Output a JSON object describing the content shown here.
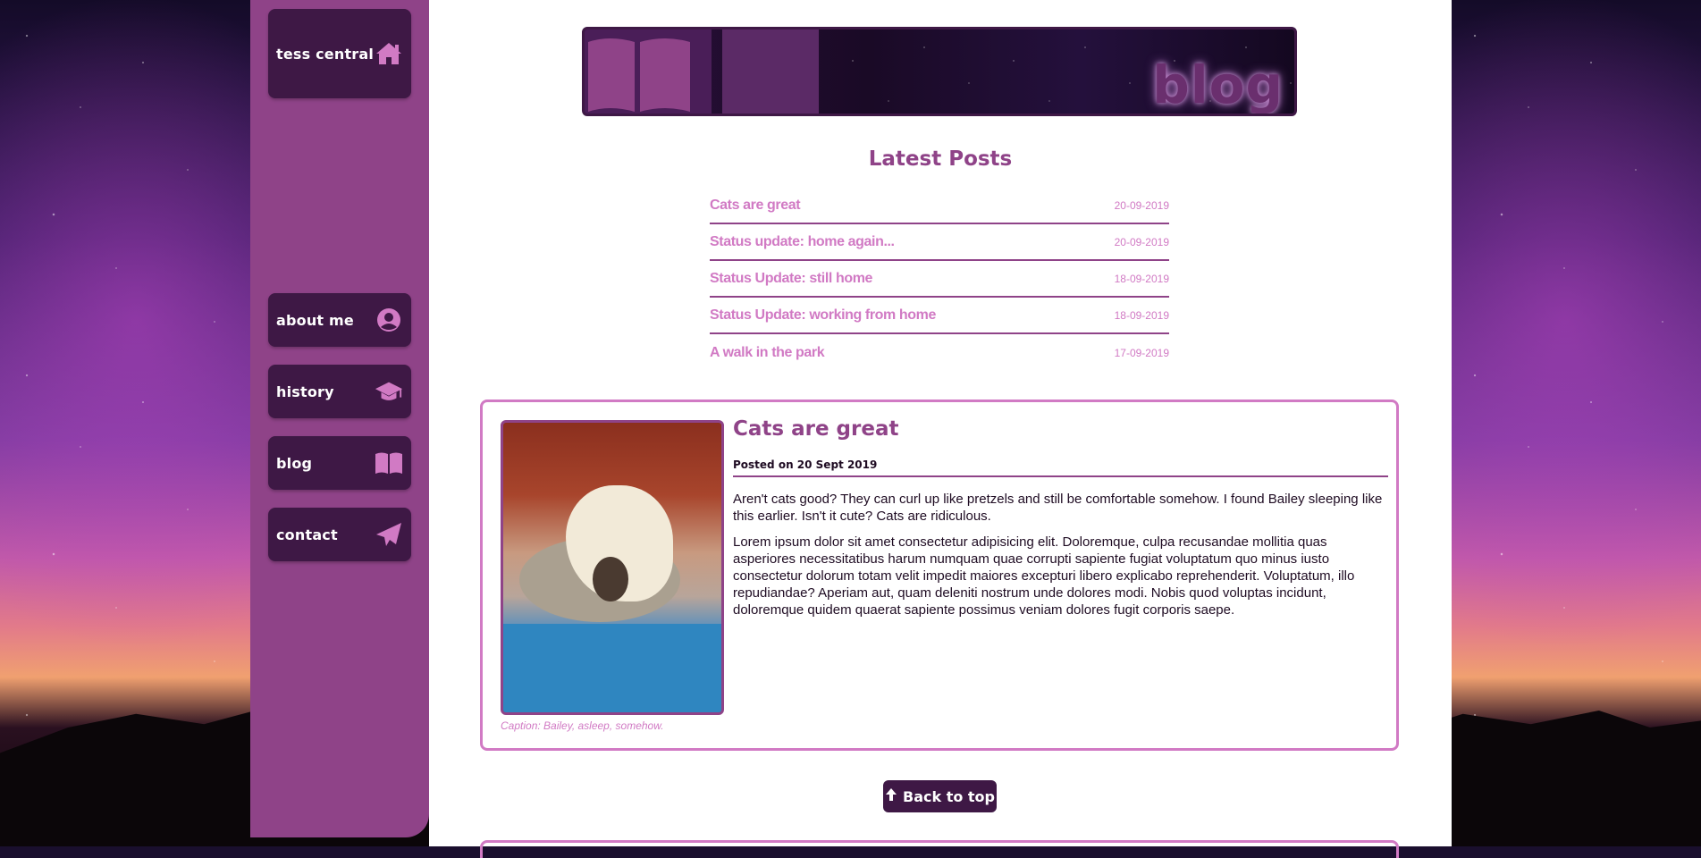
{
  "nav": {
    "home": "tess central",
    "items": [
      {
        "label": "about me",
        "icon": "user-circle-icon"
      },
      {
        "label": "history",
        "icon": "graduation-cap-icon"
      },
      {
        "label": "blog",
        "icon": "book-open-icon"
      },
      {
        "label": "contact",
        "icon": "paper-plane-icon"
      }
    ]
  },
  "banner": {
    "title": "blog"
  },
  "latest": {
    "heading": "Latest Posts",
    "posts": [
      {
        "title": "Cats are great",
        "date": "20-09-2019"
      },
      {
        "title": "Status update: home again...",
        "date": "20-09-2019"
      },
      {
        "title": "Status Update: still home",
        "date": "18-09-2019"
      },
      {
        "title": "Status Update: working from home",
        "date": "18-09-2019"
      },
      {
        "title": "A walk in the park",
        "date": "17-09-2019"
      }
    ]
  },
  "post": {
    "title": "Cats are great",
    "meta": "Posted on 20 Sept 2019",
    "caption": "Caption: Bailey, asleep, somehow.",
    "paragraphs": [
      "Aren't cats good? They can curl up like pretzels and still be comfortable somehow. I found Bailey sleeping like this earlier. Isn't it cute? Cats are ridiculous.",
      "Lorem ipsum dolor sit amet consectetur adipisicing elit. Doloremque, culpa recusandae mollitia quas asperiores necessitatibus harum numquam quae corrupti sapiente fugiat voluptatum quo minus iusto consectetur dolorum totam velit impedit maiores excepturi libero explicabo reprehenderit. Voluptatum, illo repudiandae? Aperiam aut, quam deleniti nostrum unde dolores modi. Nobis quod voluptas incidunt, doloremque quidem quaerat sapiente possimus veniam dolores fugit corporis saepe."
    ]
  },
  "back_to_top": "Back to top",
  "colors": {
    "sidebar": "#8f4388",
    "button": "#3e1845",
    "accent": "#d17ac4",
    "heading": "#8f4388"
  }
}
